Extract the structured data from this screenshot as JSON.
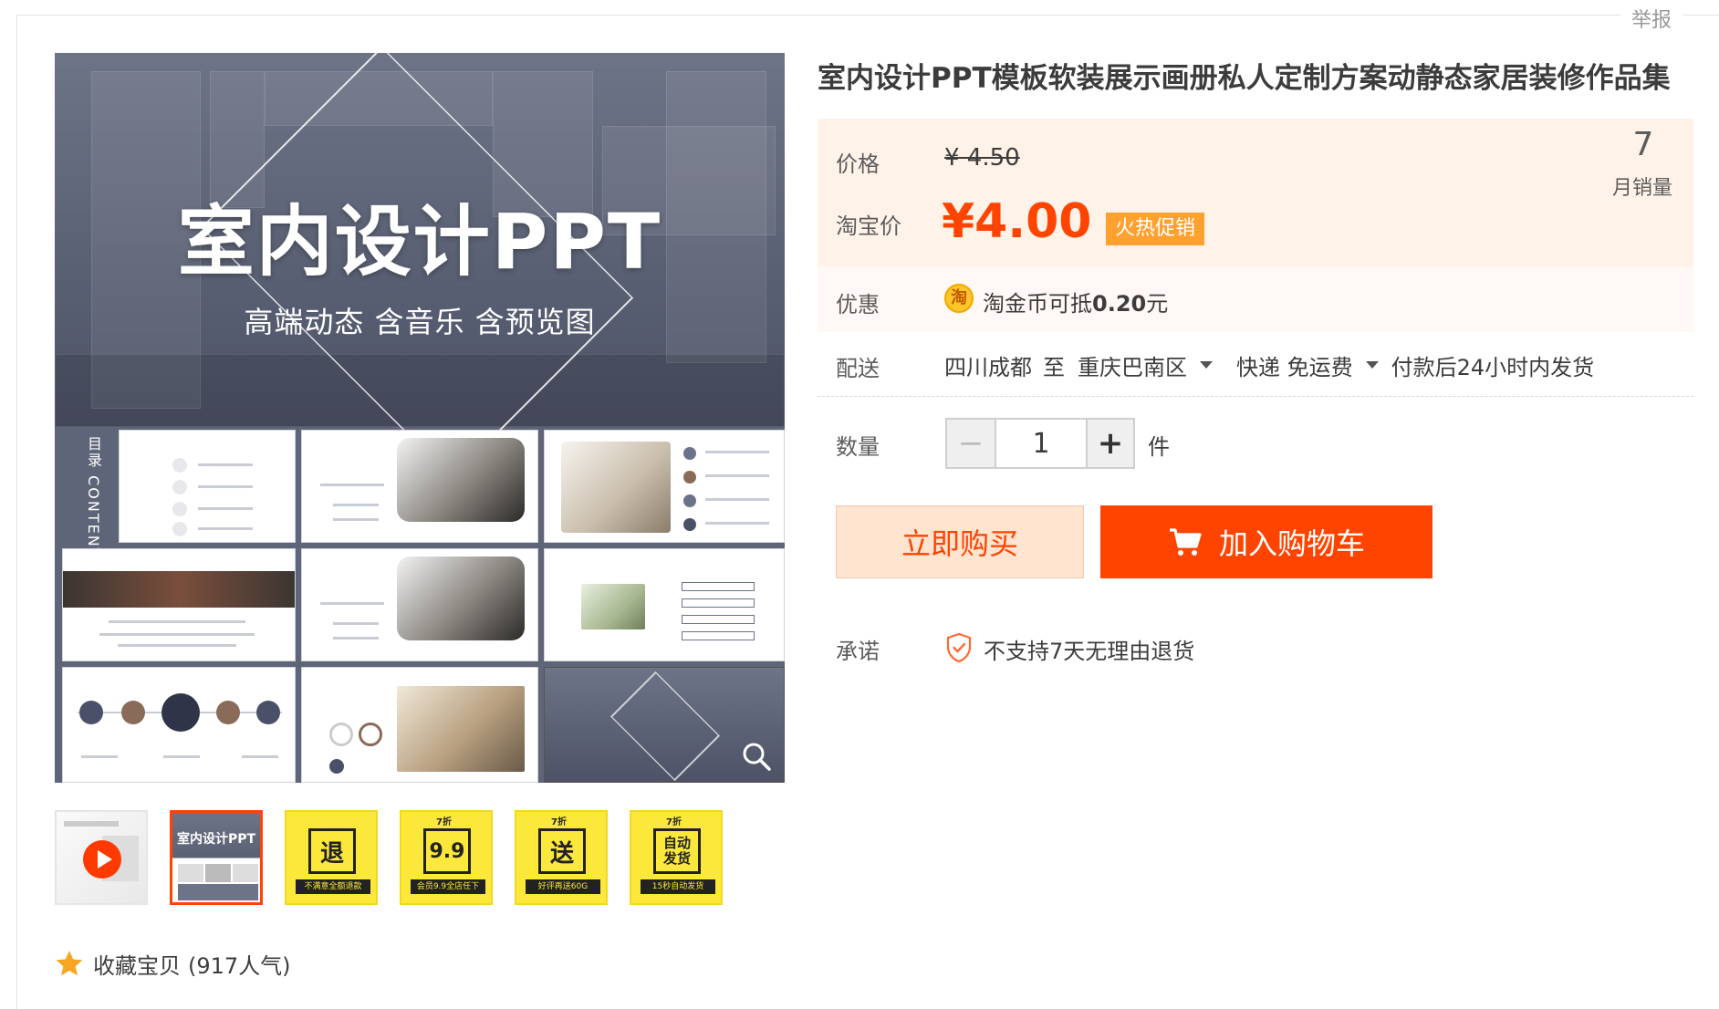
{
  "header": {
    "report_label": "举报"
  },
  "product": {
    "title": "室内设计PPT模板软装展示画册私人定制方案动静态家居装修作品集",
    "price_label": "价格",
    "original_price": "¥ 4.50",
    "taobao_price_label": "淘宝价",
    "current_price": "¥4.00",
    "hot_badge": "火热促销",
    "monthly_sales": "7",
    "monthly_sales_label": "月销量",
    "promo_label": "优惠",
    "coin_icon_char": "淘",
    "promo_text_prefix": "淘金币可抵",
    "promo_amount": "0.20",
    "promo_unit": "元",
    "shipping_label": "配送",
    "ship_from": "四川成都",
    "ship_to_word": "至",
    "ship_to": "重庆巴南区",
    "ship_method": "快递 免运费",
    "ship_time": "付款后24小时内发货",
    "quantity_label": "数量",
    "quantity_minus": "−",
    "quantity_value": "1",
    "quantity_plus": "+",
    "quantity_unit": "件",
    "buy_now_label": "立即购买",
    "add_cart_label": "加入购物车",
    "promise_label": "承诺",
    "promise_text": "不支持7天无理由退货"
  },
  "gallery": {
    "main_image": {
      "title": "室内设计PPT",
      "subtitle": "高端动态 含音乐 含预览图",
      "contents_label": "目录 CONTENTS"
    },
    "thumbnails": [
      {
        "type": "video"
      },
      {
        "type": "image",
        "text": "室内设计PPT"
      },
      {
        "type": "badge",
        "text": "退",
        "bar": "不满意全额退款"
      },
      {
        "type": "badge",
        "tag": "7折",
        "text": "9.9",
        "bar": "会员9.9全店任下"
      },
      {
        "type": "badge",
        "tag": "7折",
        "text": "送",
        "bar": "好评再送60G"
      },
      {
        "type": "badge",
        "tag": "7折",
        "text": "自动发货",
        "bar": "15秒自动发货"
      }
    ]
  },
  "favorite": {
    "label": "收藏宝贝",
    "popularity": "(917人气)"
  },
  "colors": {
    "accent": "#ff4400",
    "price_bg": "#fff2e8",
    "hot_badge": "#ffa130",
    "buy_now_bg": "#ffe4d0",
    "badge_yellow": "#fbe83a",
    "hero_slate": "#5f6578"
  },
  "icons": [
    "coin-icon",
    "caret-down-icon",
    "cart-icon",
    "shield-check-icon",
    "star-icon",
    "play-icon",
    "magnifier-icon"
  ]
}
